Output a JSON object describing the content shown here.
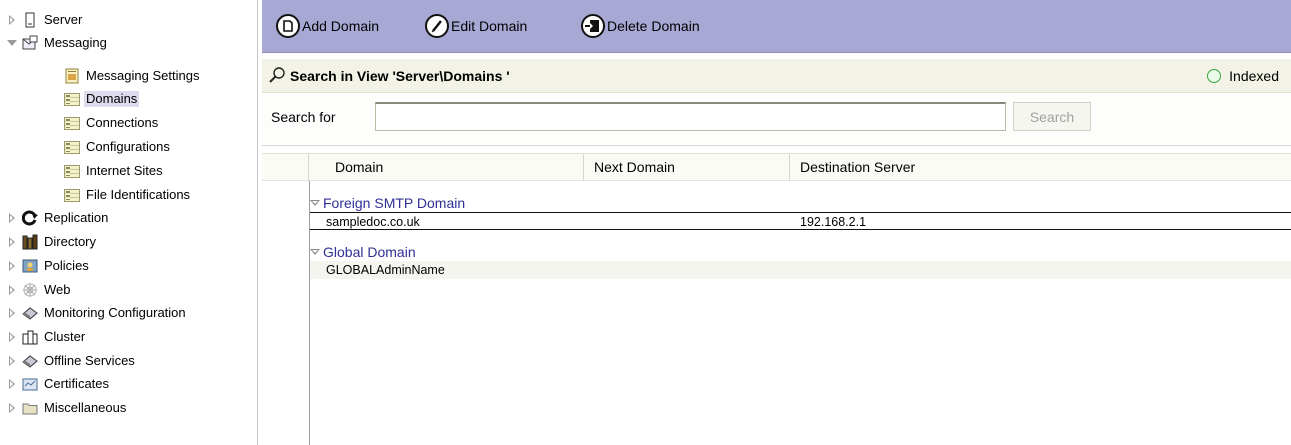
{
  "sidebar": {
    "items": [
      {
        "label": "Server",
        "icon": "server-icon"
      },
      {
        "label": "Messaging",
        "icon": "messaging-icon"
      },
      {
        "label": "Messaging Settings",
        "icon": "settings-doc-icon"
      },
      {
        "label": "Domains",
        "icon": "view-icon"
      },
      {
        "label": "Connections",
        "icon": "view-icon"
      },
      {
        "label": "Configurations",
        "icon": "view-icon"
      },
      {
        "label": "Internet Sites",
        "icon": "view-icon"
      },
      {
        "label": "File Identifications",
        "icon": "view-icon"
      },
      {
        "label": "Replication",
        "icon": "replication-icon"
      },
      {
        "label": "Directory",
        "icon": "directory-icon"
      },
      {
        "label": "Policies",
        "icon": "policies-icon"
      },
      {
        "label": "Web",
        "icon": "web-icon"
      },
      {
        "label": "Monitoring Configuration",
        "icon": "monitoring-icon"
      },
      {
        "label": "Cluster",
        "icon": "cluster-icon"
      },
      {
        "label": "Offline Services",
        "icon": "offline-services-icon"
      },
      {
        "label": "Certificates",
        "icon": "certificates-icon"
      },
      {
        "label": "Miscellaneous",
        "icon": "folder-icon"
      }
    ],
    "selected": "Domains"
  },
  "toolbar": {
    "add_label": "Add Domain",
    "edit_label": "Edit Domain",
    "delete_label": "Delete Domain"
  },
  "search_header": {
    "title": "Search in View 'Server\\Domains '",
    "indexed_label": "Indexed"
  },
  "search": {
    "label": "Search for",
    "value": "",
    "placeholder": "",
    "button_label": "Search"
  },
  "grid": {
    "columns": [
      "Domain",
      "Next Domain",
      "Destination Server"
    ],
    "categories": [
      {
        "name": "Foreign SMTP Domain",
        "rows": [
          {
            "domain": "sampledoc.co.uk",
            "next_domain": "",
            "destination_server": "192.168.2.1"
          }
        ]
      },
      {
        "name": "Global Domain",
        "rows": [
          {
            "domain": "GLOBALAdminName",
            "next_domain": "",
            "destination_server": ""
          }
        ]
      }
    ]
  },
  "colors": {
    "toolbar_bg": "#a7a8d3",
    "category_text": "#2f2f96",
    "indexed_dot": "#3fa43f",
    "selected_bg": "#dcdcec"
  }
}
